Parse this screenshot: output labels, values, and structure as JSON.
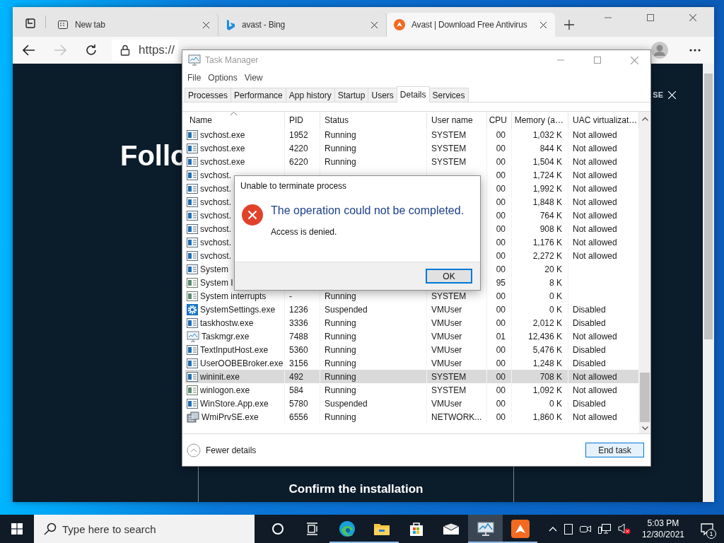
{
  "browser": {
    "tabs": [
      {
        "title": "New tab",
        "kind": "newtab",
        "selected": false
      },
      {
        "title": "avast - Bing",
        "kind": "bing",
        "selected": false
      },
      {
        "title": "Avast | Download Free Antivirus",
        "kind": "avast",
        "selected": true
      }
    ],
    "address": "https://",
    "page": {
      "banner_text": "SE",
      "heading": "Follo",
      "card_title": "Confirm the installation"
    }
  },
  "task_manager": {
    "title": "Task Manager",
    "menu": [
      "File",
      "Options",
      "View"
    ],
    "tabs": [
      {
        "label": "Processes",
        "selected": false
      },
      {
        "label": "Performance",
        "selected": false
      },
      {
        "label": "App history",
        "selected": false
      },
      {
        "label": "Startup",
        "selected": false
      },
      {
        "label": "Users",
        "selected": false
      },
      {
        "label": "Details",
        "selected": true
      },
      {
        "label": "Services",
        "selected": false
      }
    ],
    "columns": [
      {
        "label": "Name",
        "sorted": true
      },
      {
        "label": "PID",
        "sorted": false
      },
      {
        "label": "Status",
        "sorted": false
      },
      {
        "label": "User name",
        "sorted": false
      },
      {
        "label": "CPU",
        "sorted": false
      },
      {
        "label": "Memory (a…",
        "sorted": false
      },
      {
        "label": "UAC virtualizat…",
        "sorted": false
      }
    ],
    "rows": [
      {
        "kind": "app",
        "name": "svchost.exe",
        "pid": "1952",
        "status": "Running",
        "user": "SYSTEM",
        "cpu": "00",
        "memory": "1,032 K",
        "uac": "Not allowed",
        "selected": false
      },
      {
        "kind": "app",
        "name": "svchost.exe",
        "pid": "4220",
        "status": "Running",
        "user": "SYSTEM",
        "cpu": "00",
        "memory": "844 K",
        "uac": "Not allowed",
        "selected": false
      },
      {
        "kind": "app",
        "name": "svchost.exe",
        "pid": "6220",
        "status": "Running",
        "user": "SYSTEM",
        "cpu": "00",
        "memory": "1,504 K",
        "uac": "Not allowed",
        "selected": false
      },
      {
        "kind": "app",
        "name": "svchost.",
        "cpu": "00",
        "memory": "1,724 K",
        "uac": "Not allowed",
        "selected": false
      },
      {
        "kind": "app",
        "name": "svchost.",
        "cpu": "00",
        "memory": "1,992 K",
        "uac": "Not allowed",
        "selected": false
      },
      {
        "kind": "app",
        "name": "svchost.",
        "cpu": "00",
        "memory": "1,848 K",
        "uac": "Not allowed",
        "selected": false
      },
      {
        "kind": "app",
        "name": "svchost.",
        "cpu": "00",
        "memory": "764 K",
        "uac": "Not allowed",
        "selected": false
      },
      {
        "kind": "app",
        "name": "svchost.",
        "cpu": "00",
        "memory": "908 K",
        "uac": "Not allowed",
        "selected": false
      },
      {
        "kind": "app",
        "name": "svchost.",
        "cpu": "00",
        "memory": "1,176 K",
        "uac": "Not allowed",
        "selected": false
      },
      {
        "kind": "app",
        "name": "svchost.",
        "cpu": "00",
        "memory": "2,272 K",
        "uac": "Not allowed",
        "selected": false
      },
      {
        "kind": "app",
        "name": "System",
        "cpu": "00",
        "memory": "20 K",
        "selected": false
      },
      {
        "kind": "system",
        "name": "System I",
        "cpu": "95",
        "memory": "8 K",
        "selected": false
      },
      {
        "kind": "system",
        "name": "System interrupts",
        "pid": "-",
        "status": "Running",
        "user": "SYSTEM",
        "cpu": "00",
        "memory": "0 K",
        "selected": false
      },
      {
        "kind": "gear",
        "name": "SystemSettings.exe",
        "pid": "1236",
        "status": "Suspended",
        "user": "VMUser",
        "cpu": "00",
        "memory": "0 K",
        "uac": "Disabled",
        "selected": false
      },
      {
        "kind": "app",
        "name": "taskhostw.exe",
        "pid": "3336",
        "status": "Running",
        "user": "VMUser",
        "cpu": "00",
        "memory": "2,012 K",
        "uac": "Disabled",
        "selected": false
      },
      {
        "kind": "monitor",
        "name": "Taskmgr.exe",
        "pid": "7488",
        "status": "Running",
        "user": "VMUser",
        "cpu": "01",
        "memory": "12,436 K",
        "uac": "Not allowed",
        "selected": false
      },
      {
        "kind": "app",
        "name": "TextInputHost.exe",
        "pid": "5360",
        "status": "Running",
        "user": "VMUser",
        "cpu": "00",
        "memory": "5,476 K",
        "uac": "Disabled",
        "selected": false
      },
      {
        "kind": "app",
        "name": "UserOOBEBroker.exe",
        "pid": "3156",
        "status": "Running",
        "user": "VMUser",
        "cpu": "00",
        "memory": "1,248 K",
        "uac": "Disabled",
        "selected": false
      },
      {
        "kind": "app",
        "name": "wininit.exe",
        "pid": "492",
        "status": "Running",
        "user": "SYSTEM",
        "cpu": "00",
        "memory": "708 K",
        "uac": "Not allowed",
        "selected": true
      },
      {
        "kind": "system",
        "name": "winlogon.exe",
        "pid": "584",
        "status": "Running",
        "user": "SYSTEM",
        "cpu": "00",
        "memory": "1,092 K",
        "uac": "Not allowed",
        "selected": false
      },
      {
        "kind": "app",
        "name": "WinStore.App.exe",
        "pid": "5780",
        "status": "Suspended",
        "user": "VMUser",
        "cpu": "00",
        "memory": "0 K",
        "uac": "Disabled",
        "selected": false
      },
      {
        "kind": "server",
        "name": "WmiPrvSE.exe",
        "pid": "6556",
        "status": "Running",
        "user": "NETWORK...",
        "cpu": "00",
        "memory": "1,860 K",
        "uac": "Not allowed",
        "selected": false
      }
    ],
    "fewer_details": "Fewer details",
    "end_task": "End task"
  },
  "dialog": {
    "title": "Unable to terminate process",
    "message": "The operation could not be completed.",
    "detail": "Access is denied.",
    "button": "OK"
  },
  "taskbar": {
    "search_placeholder": "Type here to search",
    "apps": [
      {
        "kind": "cortana",
        "running": false,
        "active": false
      },
      {
        "kind": "taskview",
        "running": false,
        "active": false
      },
      {
        "kind": "edge",
        "running": true,
        "active": false
      },
      {
        "kind": "folder",
        "running": true,
        "active": false
      },
      {
        "kind": "store",
        "running": false,
        "active": false
      },
      {
        "kind": "mail",
        "running": false,
        "active": false
      },
      {
        "kind": "monitor",
        "running": true,
        "active": true
      },
      {
        "kind": "avast",
        "running": true,
        "active": false
      }
    ],
    "time": "5:03 PM",
    "date": "12/30/2021",
    "notifications": "1"
  }
}
